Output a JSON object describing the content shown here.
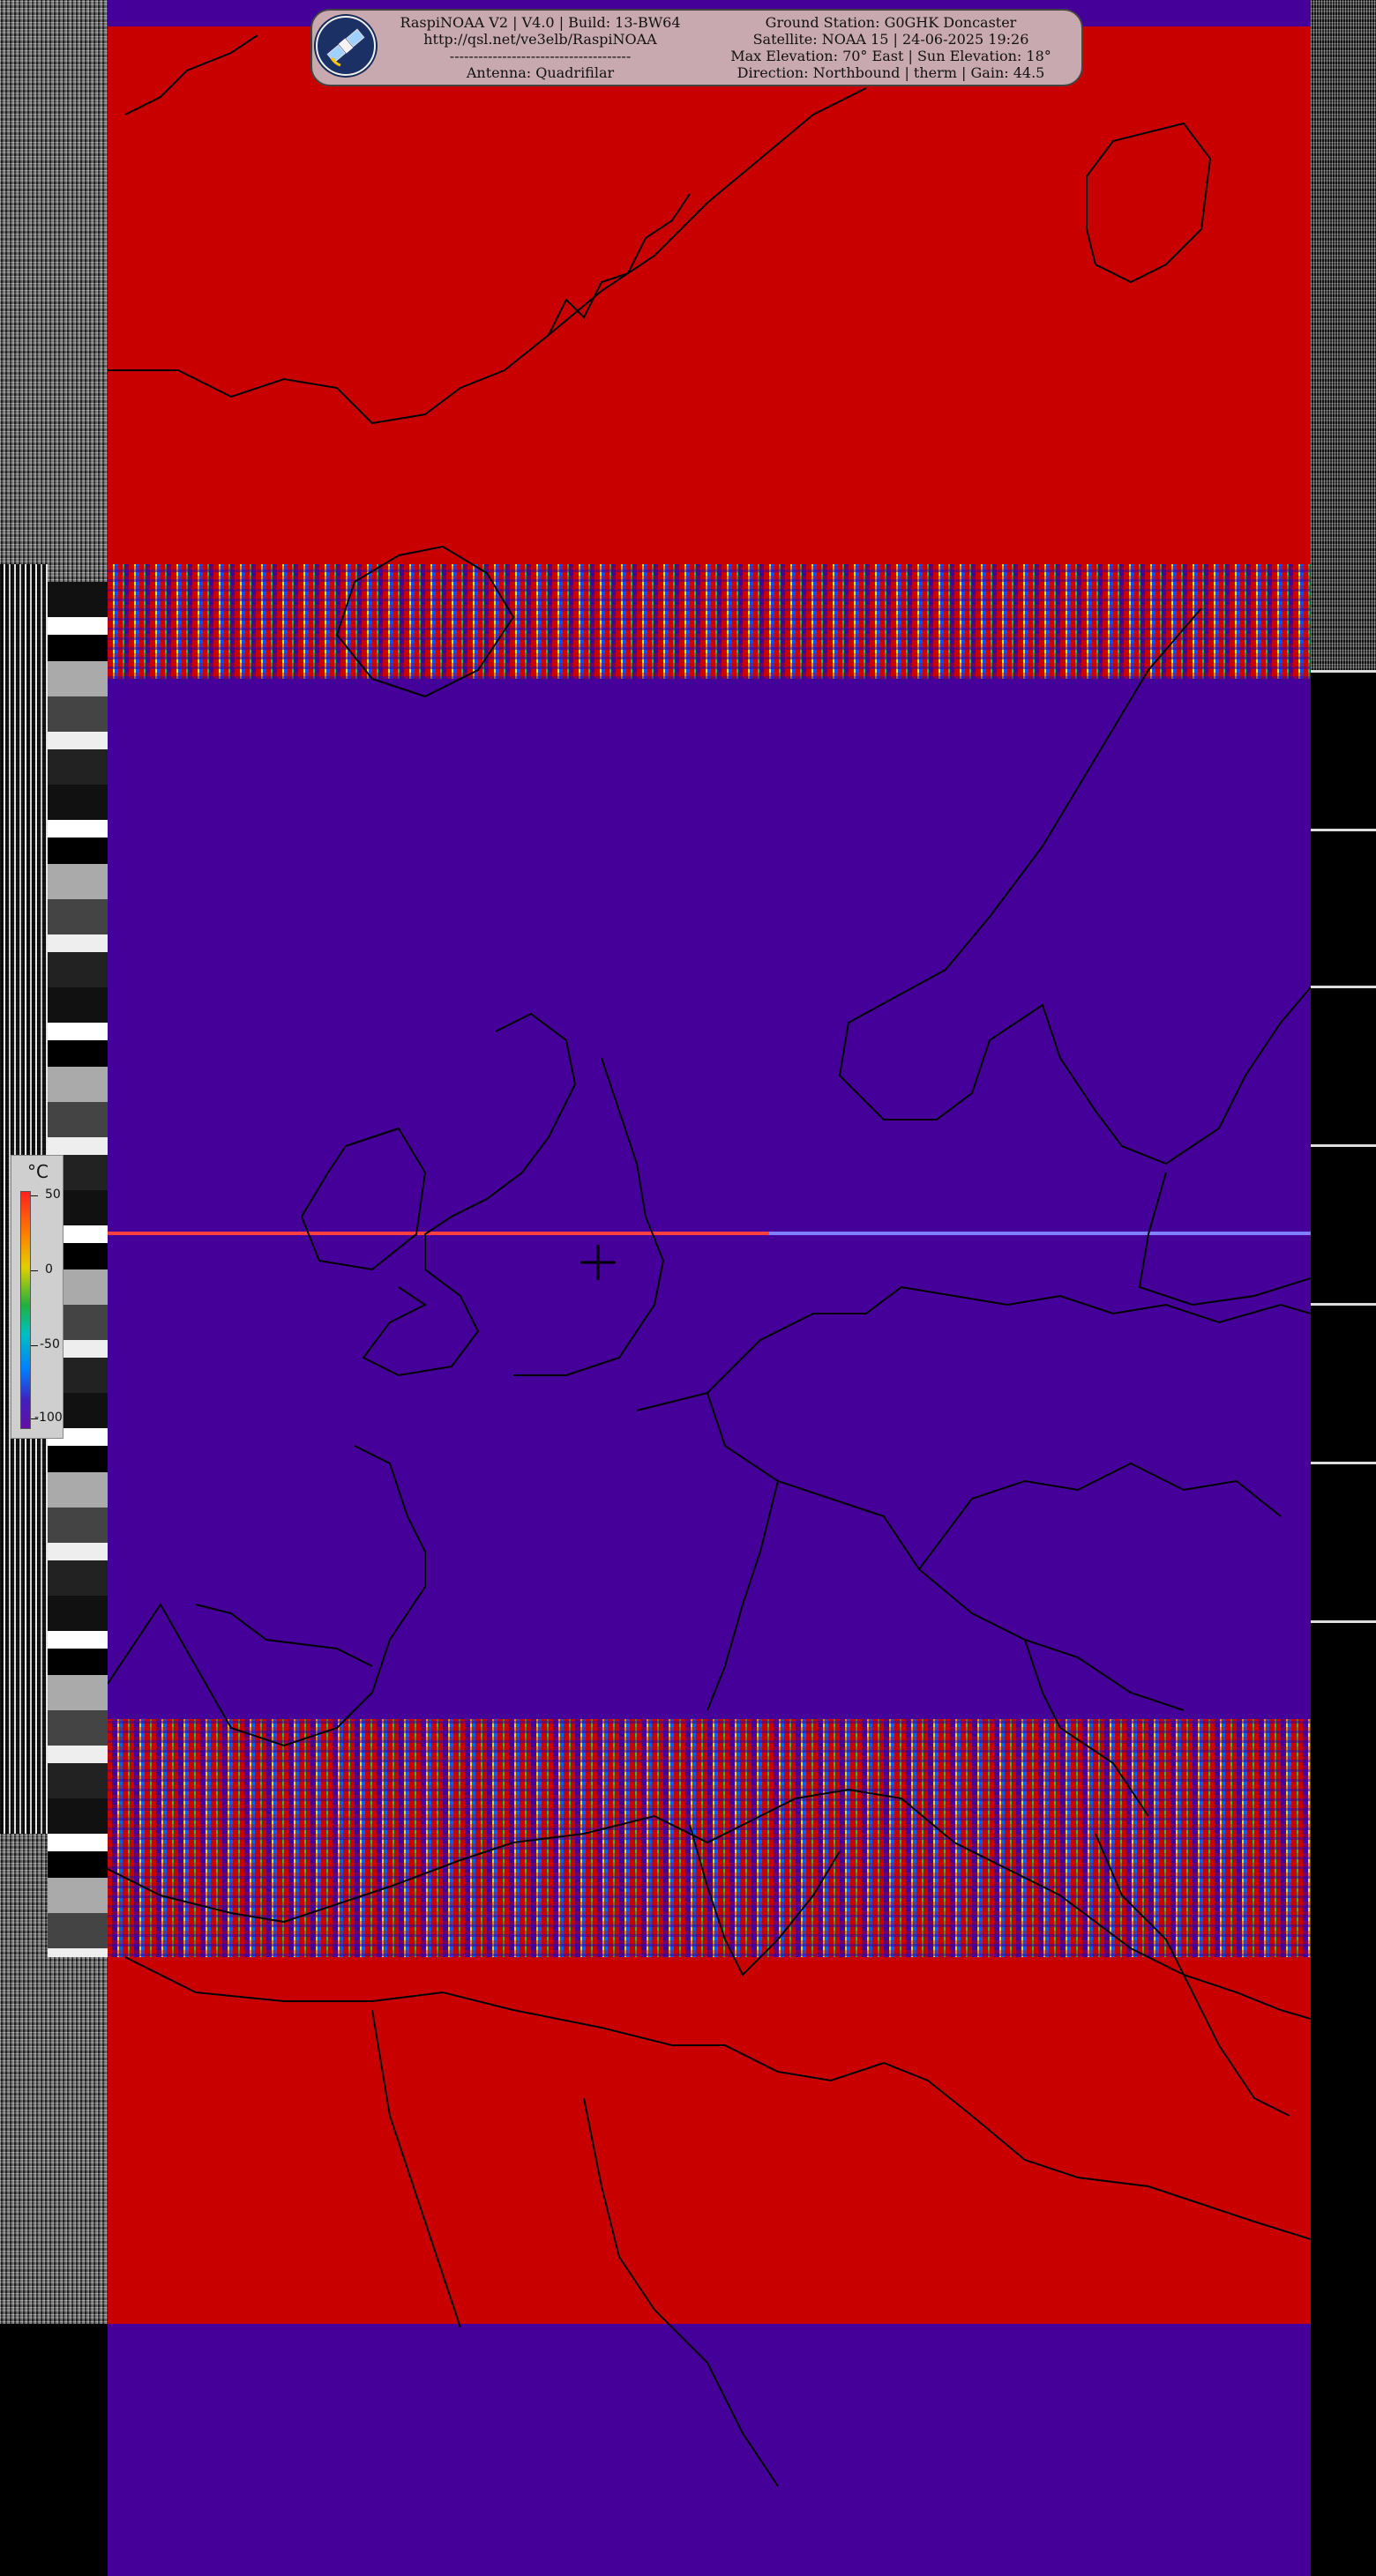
{
  "header": {
    "left_lines": [
      "RaspiNOAA V2 | V4.0 | Build: 13-BW64",
      "http://qsl.net/ve3elb/RaspiNOAA",
      "--------------------------------------",
      "Antenna: Quadrifilar"
    ],
    "right_lines": [
      "Ground Station: G0GHK Doncaster",
      "Satellite: NOAA 15 | 24-06-2025 19:26",
      "Max Elevation: 70° East | Sun Elevation: 18°",
      "Direction: Northbound | therm | Gain: 44.5"
    ],
    "logo_icon": "satellite-icon"
  },
  "temperature_legend": {
    "unit": "°C",
    "ticks": [
      "50",
      "0",
      "-50",
      "-100"
    ]
  },
  "palette": {
    "hot_red": "#c80000",
    "cold_purple": "#440098",
    "panel_bg": "#c9a9b0",
    "logo_bg": "#172a56"
  },
  "markers": {
    "ground_station_icon": "crosshair-icon"
  }
}
